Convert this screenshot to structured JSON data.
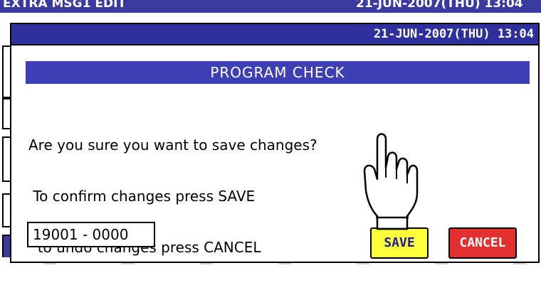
{
  "background_screen": {
    "title": "EXTRA MSG1 EDIT",
    "datetime": "21-JUN-2007(THU) 13:04"
  },
  "dialog": {
    "datetime": "21-JUN-2007(THU) 13:04",
    "title": "PROGRAM CHECK",
    "message_lines": [
      "Are you sure you want to save changes?",
      " To confirm changes press SAVE",
      "  to undo changes press CANCEL"
    ],
    "code_value": "19001 - 0000",
    "save_label": "SAVE",
    "cancel_label": "CANCEL"
  },
  "colors": {
    "header_blue": "#2f2f9e",
    "title_blue": "#3f3fb5",
    "save_yellow": "#ffff3c",
    "cancel_red": "#e23030"
  },
  "icons": {
    "pointer": "hand-pointer-icon"
  }
}
